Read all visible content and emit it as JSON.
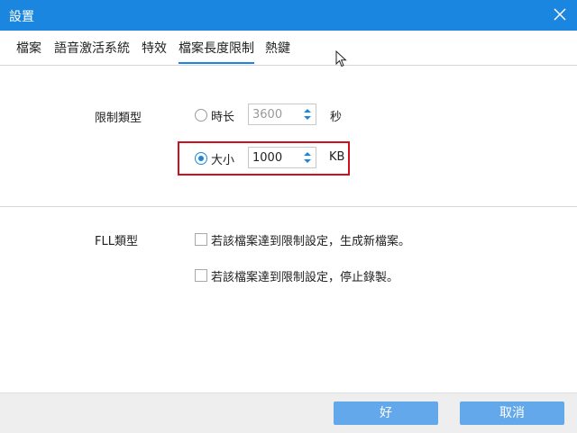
{
  "window": {
    "title": "設置"
  },
  "tabs": [
    {
      "label": "檔案"
    },
    {
      "label": "語音激活系統"
    },
    {
      "label": "特效"
    },
    {
      "label": "檔案長度限制"
    },
    {
      "label": "熱鍵"
    }
  ],
  "limit_section": {
    "label": "限制類型",
    "option_time": {
      "label": "時长",
      "value": "3600",
      "unit": "秒",
      "selected": false
    },
    "option_size": {
      "label": "大小",
      "value": "1000",
      "unit": "KB",
      "selected": true
    }
  },
  "fll_section": {
    "label": "FLL類型",
    "option_new_file": {
      "label": "若該檔案達到限制設定，生成新檔案。",
      "checked": false
    },
    "option_stop": {
      "label": "若該檔案達到限制設定，停止錄製。",
      "checked": false
    }
  },
  "footer": {
    "ok_label": "好",
    "cancel_label": "取消"
  },
  "colors": {
    "accent": "#1b86e0",
    "highlight": "#d0101c",
    "button": "#64a8ec"
  },
  "icons": {
    "close": "close-icon",
    "cursor": "mouse-cursor-icon"
  }
}
